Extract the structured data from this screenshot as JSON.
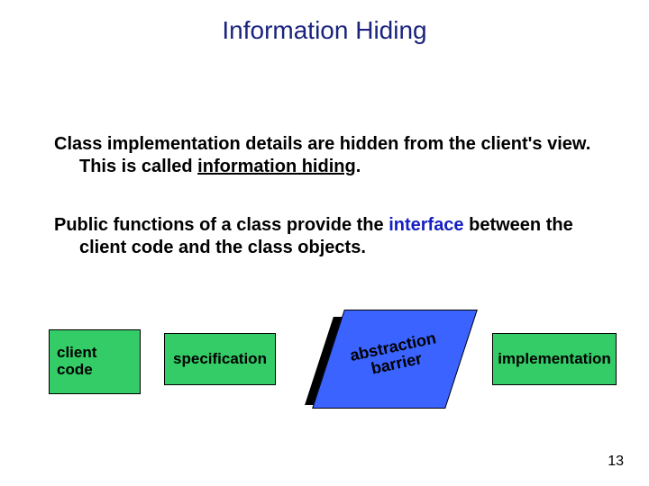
{
  "title": "Information Hiding",
  "para1_a": "Class implementation details are hidden from the client's view.  This is called ",
  "para1_b": "information hiding",
  "para1_c": ".",
  "para2_a": "Public functions of a class provide the ",
  "para2_b": "interface",
  "para2_c": " between the client code and the class objects.",
  "boxes": {
    "client": "client\ncode",
    "spec": "specification",
    "barrier": "abstraction\nbarrier",
    "impl": "implementation"
  },
  "page_number": "13"
}
